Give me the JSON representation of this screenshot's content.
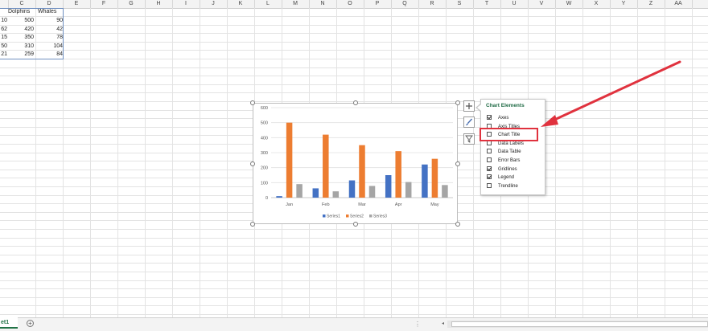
{
  "columns": [
    "C",
    "D",
    "E",
    "F",
    "G",
    "H",
    "I",
    "J",
    "K",
    "L",
    "M",
    "N",
    "O",
    "P",
    "Q",
    "R",
    "S",
    "T",
    "U",
    "V",
    "W",
    "X",
    "Y",
    "Z",
    "AA"
  ],
  "table": {
    "headers": [
      "Dolphins",
      "Whales"
    ],
    "rows": [
      {
        "b": "10",
        "c": "500",
        "d": "90"
      },
      {
        "b": "62",
        "c": "420",
        "d": "42"
      },
      {
        "b": "15",
        "c": "350",
        "d": "78"
      },
      {
        "b": "50",
        "c": "310",
        "d": "104"
      },
      {
        "b": "21",
        "c": "259",
        "d": "84"
      }
    ]
  },
  "chart_data": {
    "type": "bar",
    "categories": [
      "Jan",
      "Feb",
      "Mar",
      "Apr",
      "May"
    ],
    "series": [
      {
        "name": "Series1",
        "color": "#4472c4",
        "values": [
          10,
          62,
          115,
          150,
          221
        ]
      },
      {
        "name": "Series2",
        "color": "#ed7d31",
        "values": [
          500,
          420,
          350,
          310,
          259
        ]
      },
      {
        "name": "Series3",
        "color": "#a5a5a5",
        "values": [
          90,
          42,
          78,
          104,
          84
        ]
      }
    ],
    "ylim": [
      0,
      600
    ],
    "yticks": [
      0,
      100,
      200,
      300,
      400,
      500,
      600
    ],
    "grid": true,
    "legend": "bottom",
    "title": ""
  },
  "panel": {
    "title": "Chart Elements",
    "options": [
      {
        "label": "Axes",
        "checked": true
      },
      {
        "label": "Axis Titles",
        "checked": false
      },
      {
        "label": "Chart Title",
        "checked": false
      },
      {
        "label": "Data Labels",
        "checked": false
      },
      {
        "label": "Data Table",
        "checked": false
      },
      {
        "label": "Error Bars",
        "checked": false
      },
      {
        "label": "Gridlines",
        "checked": true
      },
      {
        "label": "Legend",
        "checked": true
      },
      {
        "label": "Trendline",
        "checked": false
      }
    ]
  },
  "side_buttons": [
    "plus-icon",
    "brush-icon",
    "filter-icon"
  ],
  "sheet_tab": "et1",
  "add_sheet": "+",
  "colors": {
    "accent": "#217346",
    "highlight": "#e0323e",
    "arrow": "#e0323e"
  }
}
